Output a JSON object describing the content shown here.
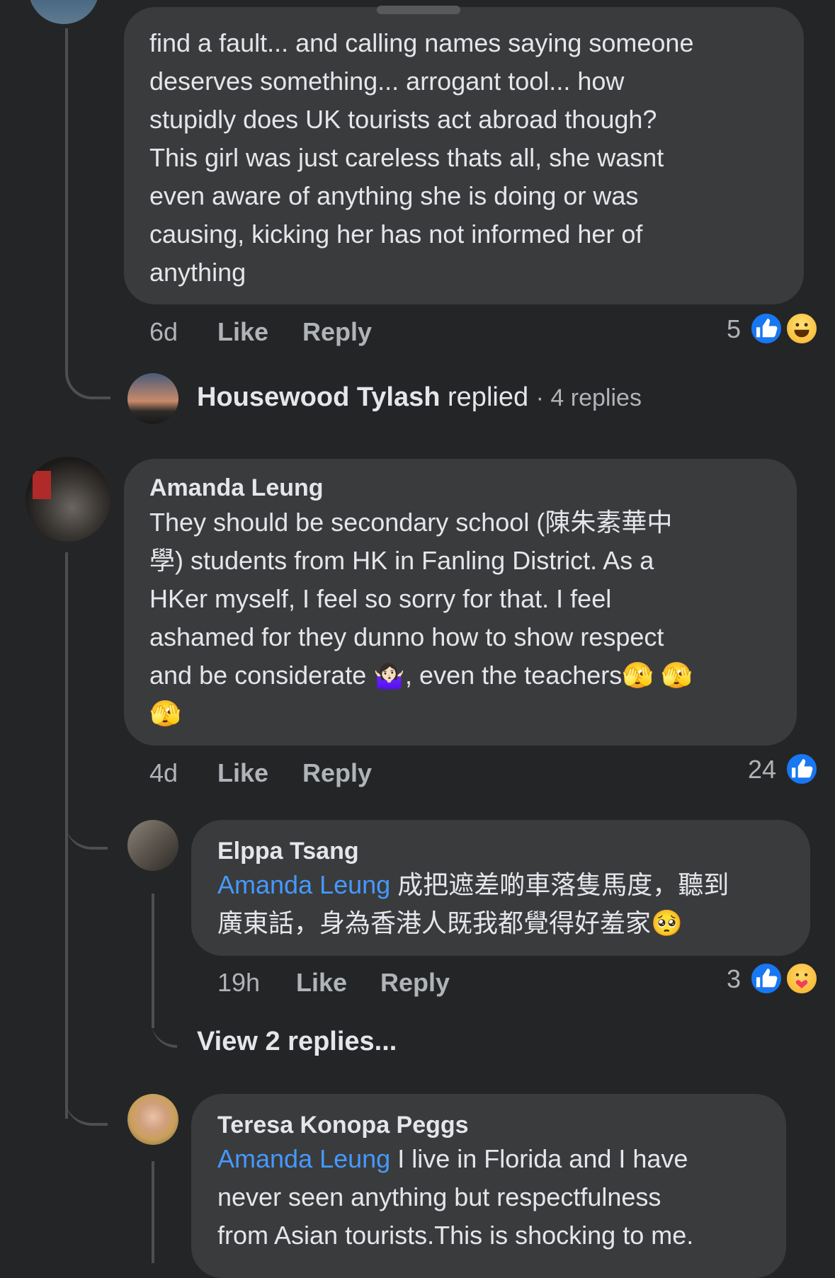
{
  "top_comment": {
    "text_lines": [
      "find a fault... and calling names saying someone",
      "deserves something... arrogant tool... how",
      "stupidly does UK tourists act abroad though?",
      "This girl was just careless thats all, she wasnt",
      "even aware of anything she is doing or was",
      "causing, kicking her has not informed her of",
      "anything"
    ],
    "time": "6d",
    "like_label": "Like",
    "reply_label": "Reply",
    "reaction_count": "5"
  },
  "reply_summary": {
    "name": "Housewood Tylash",
    "action": "replied",
    "count": "· 4 replies"
  },
  "amanda_comment": {
    "name": "Amanda Leung",
    "text_lines": [
      "They should be secondary school (陳朱素華中",
      "學) students from HK in Fanling District. As a",
      "HKer myself, I feel so sorry for that. I feel",
      "ashamed for they dunno how to show respect",
      "and be considerate 🤷🏻‍♀️, even the teachers🫣 🫣",
      "🫣"
    ],
    "time": "4d",
    "like_label": "Like",
    "reply_label": "Reply",
    "reaction_count": "24"
  },
  "elppa_reply": {
    "name": "Elppa Tsang",
    "mention": "Amanda Leung",
    "text_line1": " 成把遮差啲車落隻馬度，聽到",
    "text_line2": "廣東話，身為香港人既我都覺得好羞家🥺",
    "time": "19h",
    "like_label": "Like",
    "reply_label": "Reply",
    "reaction_count": "3"
  },
  "view_replies": "View 2 replies...",
  "teresa_reply": {
    "name": "Teresa Konopa Peggs",
    "mention": "Amanda Leung",
    "text_line1": " I live in Florida and I have",
    "text_line2": "never seen anything but respectfulness",
    "text_line3": "from Asian tourists.This is shocking to me."
  }
}
